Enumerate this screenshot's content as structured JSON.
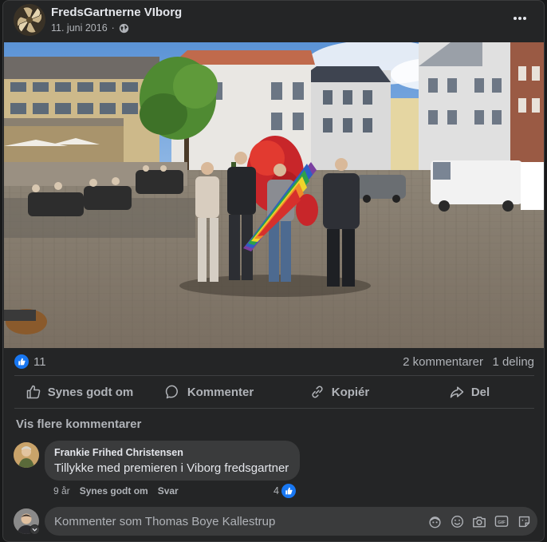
{
  "post": {
    "page_name": "FredsGartnerne VIborg",
    "date": "11. juni 2016",
    "privacy_icon": "globe-icon",
    "more_icon": "more-horizontal-icon"
  },
  "stats": {
    "reaction_icon": "like-icon",
    "likes": "11",
    "comments": "2 kommentarer",
    "shares": "1 deling"
  },
  "actions": [
    {
      "label": "Synes godt om",
      "icon": "thumbs-up-icon"
    },
    {
      "label": "Kommenter",
      "icon": "comment-icon"
    },
    {
      "label": "Kopiér",
      "icon": "link-icon"
    },
    {
      "label": "Del",
      "icon": "share-icon"
    }
  ],
  "more_comments": "Vis flere kommentarer",
  "comment": {
    "author": "Frankie Frihed Christensen",
    "text": "Tillykke med premieren i Viborg fredsgartner",
    "age": "9 år",
    "like_label": "Synes godt om",
    "reply_label": "Svar",
    "reaction_count": "4"
  },
  "compose": {
    "placeholder": "Kommenter som Thomas Boye Kallestrup",
    "icons": [
      "avatar-sticker-icon",
      "emoji-icon",
      "camera-icon",
      "gif-icon",
      "sticker-icon"
    ]
  },
  "colors": {
    "background": "#242526",
    "accent": "#1877f2",
    "bubble": "#3a3b3c",
    "secondary_text": "#b0b3b8"
  }
}
